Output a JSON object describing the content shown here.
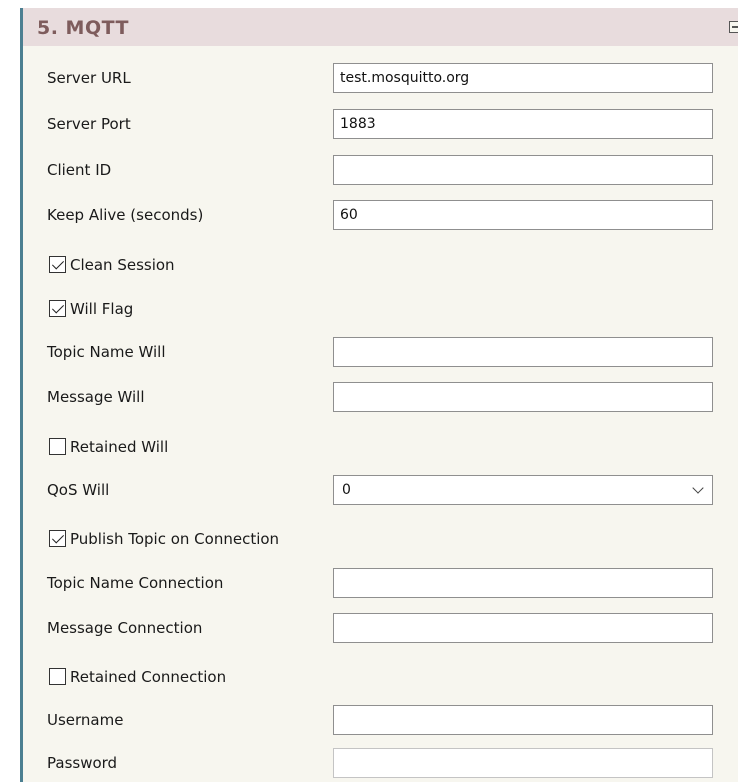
{
  "section": {
    "title": "5. MQTT"
  },
  "fields": {
    "server_url": {
      "label": "Server URL",
      "value": "test.mosquitto.org"
    },
    "server_port": {
      "label": "Server Port",
      "value": "1883"
    },
    "client_id": {
      "label": "Client ID",
      "value": ""
    },
    "keep_alive": {
      "label": "Keep Alive (seconds)",
      "value": "60"
    },
    "clean_session": {
      "label": "Clean Session",
      "checked": true
    },
    "will_flag": {
      "label": "Will Flag",
      "checked": true
    },
    "topic_name_will": {
      "label": "Topic Name Will",
      "value": ""
    },
    "message_will": {
      "label": "Message Will",
      "value": ""
    },
    "retained_will": {
      "label": "Retained Will",
      "checked": false
    },
    "qos_will": {
      "label": "QoS Will",
      "value": "0"
    },
    "publish_topic_on_connection": {
      "label": "Publish Topic on Connection",
      "checked": true
    },
    "topic_name_connection": {
      "label": "Topic Name Connection",
      "value": ""
    },
    "message_connection": {
      "label": "Message Connection",
      "value": ""
    },
    "retained_connection": {
      "label": "Retained Connection",
      "checked": false
    },
    "username": {
      "label": "Username",
      "value": ""
    },
    "password": {
      "label": "Password",
      "value": ""
    }
  }
}
